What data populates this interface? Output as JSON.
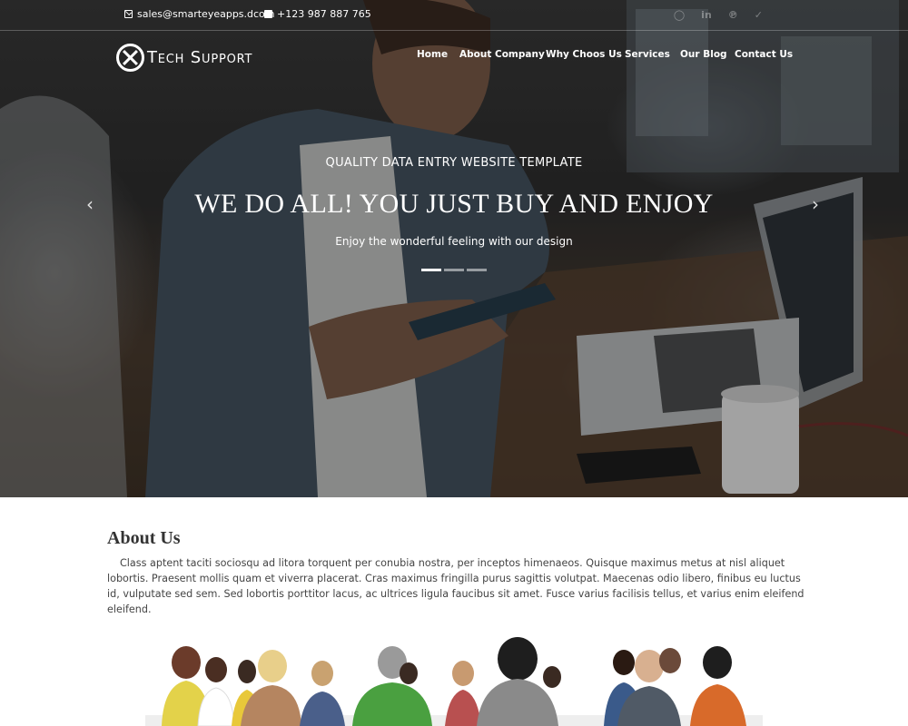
{
  "topbar": {
    "email": "sales@smarteyeapps.dcom",
    "phone": "+123 987 887 765",
    "socials": [
      "github-icon",
      "linkedin-icon",
      "pinterest-icon",
      "twitter-icon"
    ]
  },
  "header": {
    "logo_text": "Tech Support",
    "nav": [
      "Home",
      "About Company",
      "Why Choos Us",
      "Services",
      "Our Blog",
      "Contact Us"
    ]
  },
  "slider": {
    "kicker": "QUALITY DATA ENTRY WEBSITE TEMPLATE",
    "headline": "WE DO ALL! YOU JUST BUY AND ENJOY",
    "subline": "Enjoy the wonderful feeling with our design",
    "slide_count": 3,
    "active_slide": 1
  },
  "about": {
    "title": "About Us",
    "text": "Class aptent taciti sociosqu ad litora torquent per conubia nostra, per inceptos himenaeos. Quisque maximus metus at nisl aliquet lobortis. Praesent mollis quam et viverra placerat. Cras maximus fringilla purus sagittis volutpat. Maecenas odio libero, finibus eu luctus id, vulputate sed sem. Sed lobortis porttitor lacus, ac ultrices ligula faucibus sit amet. Fusce varius facilisis tellus, et varius enim eleifend eleifend."
  },
  "colors": {
    "text": "#333333",
    "white": "#ffffff"
  }
}
